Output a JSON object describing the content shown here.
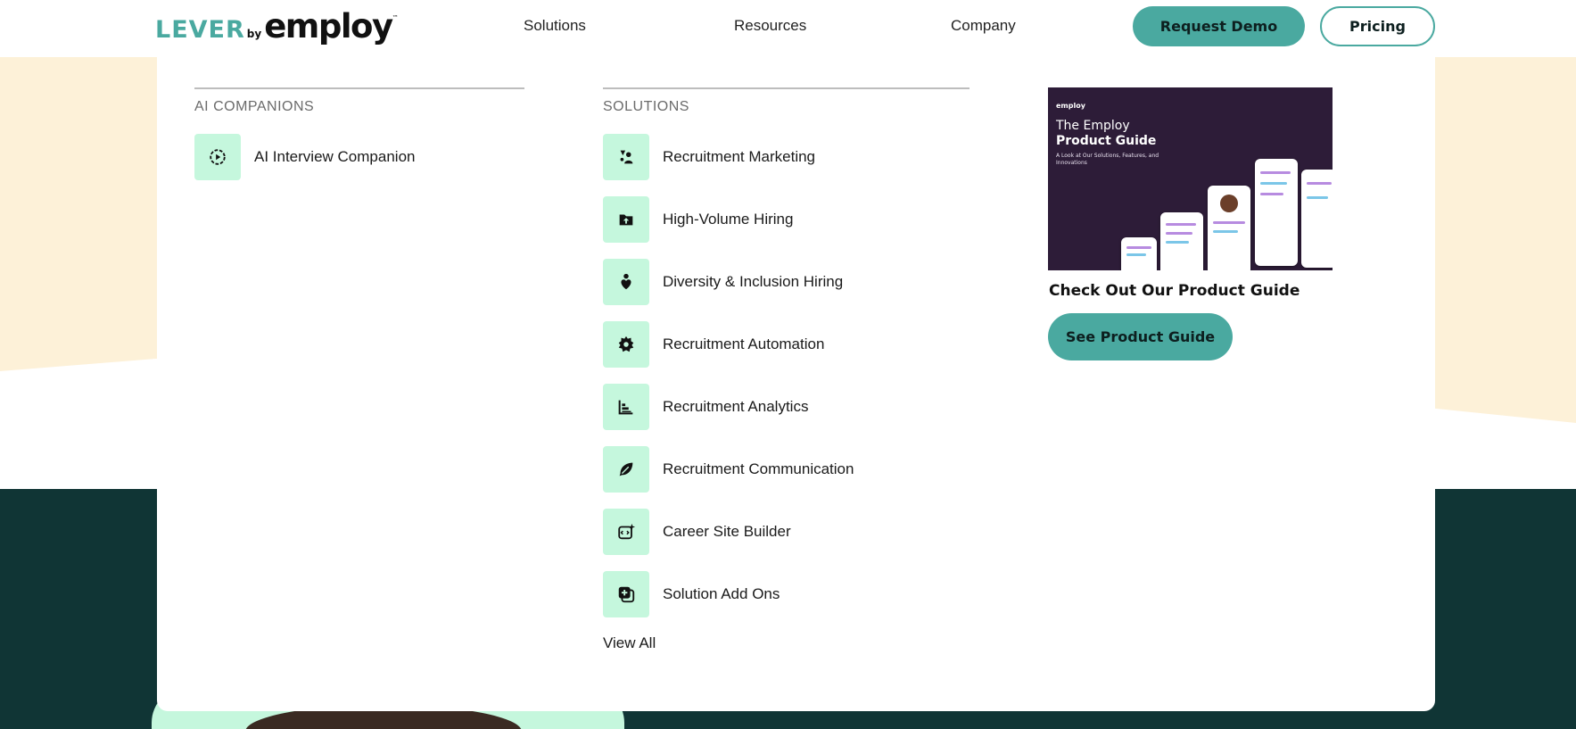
{
  "header": {
    "logo_lever": "LEVER",
    "logo_by": "by",
    "logo_employ": "employ",
    "logo_tm": "™",
    "nav": [
      "Solutions",
      "Resources",
      "Company"
    ],
    "request_demo_label": "Request Demo",
    "pricing_label": "Pricing"
  },
  "dropdown": {
    "ai_companions": {
      "heading": "AI COMPANIONS",
      "items": [
        {
          "label": "AI Interview Companion",
          "icon": "play-circle-icon"
        }
      ]
    },
    "solutions": {
      "heading": "SOLUTIONS",
      "items": [
        {
          "label": "Recruitment Marketing",
          "icon": "megaphone-people-icon"
        },
        {
          "label": "High-Volume Hiring",
          "icon": "folder-upload-icon"
        },
        {
          "label": "Diversity & Inclusion Hiring",
          "icon": "person-heart-icon"
        },
        {
          "label": "Recruitment Automation",
          "icon": "gear-icon"
        },
        {
          "label": "Recruitment Analytics",
          "icon": "bar-chart-icon"
        },
        {
          "label": "Recruitment Communication",
          "icon": "send-icon"
        },
        {
          "label": "Career Site Builder",
          "icon": "code-sparkle-icon"
        },
        {
          "label": "Solution Add Ons",
          "icon": "add-square-icon"
        }
      ],
      "view_all_label": "View All"
    },
    "promo": {
      "image_brand": "employ",
      "image_title_line1": "The Employ",
      "image_title_line2": "Product Guide",
      "image_subtitle": "A Look at Our Solutions, Features, and Innovations",
      "caption": "Check Out Our Product Guide",
      "button_label": "See Product Guide"
    }
  },
  "colors": {
    "accent_teal": "#4aa9a0",
    "mint_tile": "#c5f7dd",
    "dark_band": "#103535",
    "cream": "#fdf1d8",
    "promo_bg": "#2d1c38"
  }
}
